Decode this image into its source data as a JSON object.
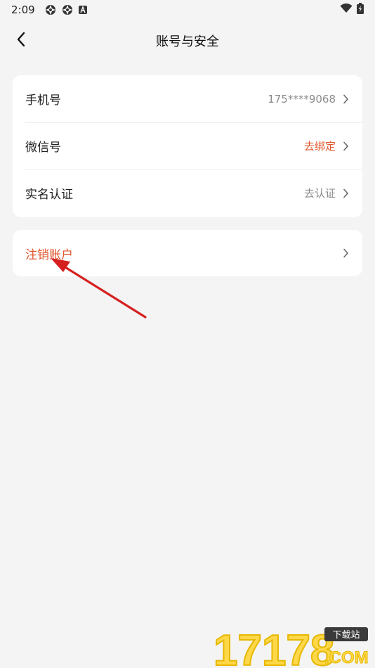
{
  "status_bar": {
    "time": "2:09",
    "icons": [
      "aperture-icon",
      "aperture-icon",
      "a-box-icon"
    ],
    "right_icons": [
      "wifi-icon",
      "battery-charging-icon"
    ]
  },
  "header": {
    "back_icon": "chevron-left-icon",
    "title": "账号与安全"
  },
  "account_items": [
    {
      "label": "手机号",
      "value": "175****9068",
      "value_color": "#8a8a8a"
    },
    {
      "label": "微信号",
      "value": "去绑定",
      "value_color": "#e2542b"
    },
    {
      "label": "实名认证",
      "value": "去认证",
      "value_color": "#8a8a8a"
    }
  ],
  "cancel_account": {
    "label": "注销账户",
    "color": "#e2542b"
  },
  "annotation": {
    "arrow_color": "#d62020"
  },
  "watermark": {
    "number": "17178",
    "badge": "下载站",
    "domain": ".COM"
  },
  "colors": {
    "background": "#f4f4f4",
    "card": "#ffffff",
    "accent": "#e2542b",
    "secondary_text": "#8a8a8a"
  }
}
